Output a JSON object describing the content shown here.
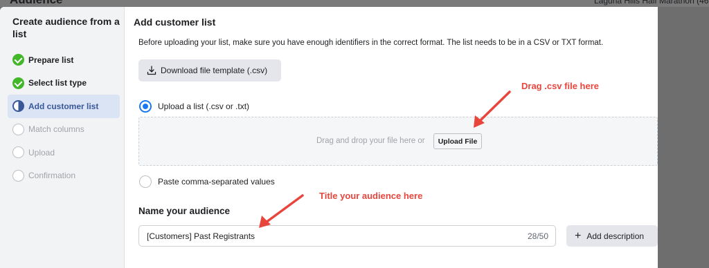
{
  "background": {
    "page_title": "Audience",
    "right_text": "Laguna Hills Half Marathon (46"
  },
  "sidebar": {
    "title": "Create audience from a list",
    "steps": [
      {
        "label": "Prepare list",
        "state": "done"
      },
      {
        "label": "Select list type",
        "state": "done"
      },
      {
        "label": "Add customer list",
        "state": "current"
      },
      {
        "label": "Match columns",
        "state": "todo"
      },
      {
        "label": "Upload",
        "state": "todo"
      },
      {
        "label": "Confirmation",
        "state": "todo"
      }
    ]
  },
  "main": {
    "title": "Add customer list",
    "intro": "Before uploading your list, make sure you have enough identifiers in the correct format. The list needs to be in a CSV or TXT format.",
    "download_label": "Download file template (.csv)",
    "upload_option": {
      "label": "Upload a list (.csv or .txt)",
      "selected": true
    },
    "dropzone": {
      "text": "Drag and drop your file here or",
      "button": "Upload File"
    },
    "paste_option": {
      "label": "Paste comma-separated values",
      "selected": false
    },
    "name_heading": "Name your audience",
    "name_input": {
      "value": "[Customers] Past Registrants",
      "count": "28/50"
    },
    "add_description_label": "Add description"
  },
  "annotations": {
    "drag": "Drag .csv file here",
    "title": "Title your audience here"
  },
  "colors": {
    "annotation_red": "#e8453c",
    "accent_blue": "#1877f2",
    "done_green": "#42b72a",
    "current_step_bg": "#dbe4f5"
  }
}
